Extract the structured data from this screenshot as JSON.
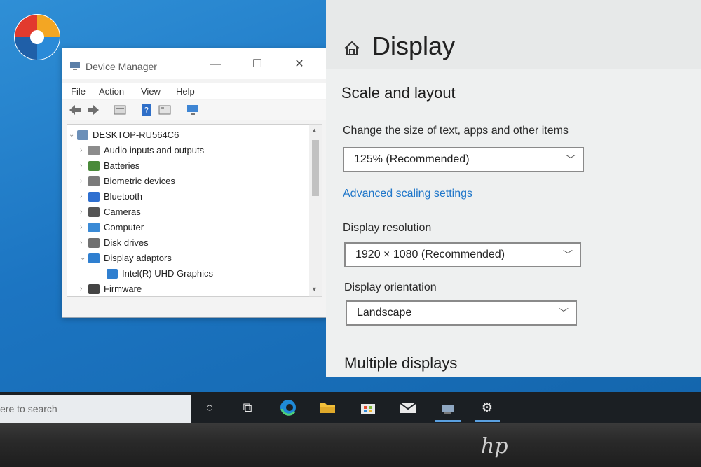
{
  "device_manager": {
    "title": "Device Manager",
    "menu": [
      "File",
      "Action",
      "View",
      "Help"
    ],
    "tree": [
      {
        "label": "DESKTOP-RU564C6",
        "level": 0,
        "expander": "⌄",
        "icon": "computer-root-icon",
        "color": "#6b8fb8"
      },
      {
        "label": "Audio inputs and outputs",
        "level": 1,
        "expander": "›",
        "icon": "speaker-icon",
        "color": "#8c8c8c"
      },
      {
        "label": "Batteries",
        "level": 1,
        "expander": "›",
        "icon": "battery-icon",
        "color": "#4a8a3a"
      },
      {
        "label": "Biometric devices",
        "level": 1,
        "expander": "›",
        "icon": "fingerprint-icon",
        "color": "#7b7b7b"
      },
      {
        "label": "Bluetooth",
        "level": 1,
        "expander": "›",
        "icon": "bluetooth-icon",
        "color": "#2e6fd0"
      },
      {
        "label": "Cameras",
        "level": 1,
        "expander": "›",
        "icon": "camera-icon",
        "color": "#555555"
      },
      {
        "label": "Computer",
        "level": 1,
        "expander": "›",
        "icon": "monitor-icon",
        "color": "#3a8ad6"
      },
      {
        "label": "Disk drives",
        "level": 1,
        "expander": "›",
        "icon": "disk-icon",
        "color": "#707070"
      },
      {
        "label": "Display adaptors",
        "level": 1,
        "expander": "⌄",
        "icon": "display-adapter-icon",
        "color": "#2f7fd0"
      },
      {
        "label": "Intel(R) UHD Graphics",
        "level": 2,
        "expander": "",
        "icon": "display-adapter-icon",
        "color": "#2f7fd0"
      },
      {
        "label": "Firmware",
        "level": 1,
        "expander": "›",
        "icon": "firmware-icon",
        "color": "#444444"
      }
    ]
  },
  "settings": {
    "page_title": "Display",
    "section_scale": "Scale and layout",
    "scale_label": "Change the size of text, apps and other items",
    "scale_value": "125% (Recommended)",
    "advanced_link": "Advanced scaling settings",
    "resolution_label": "Display resolution",
    "resolution_value": "1920 × 1080 (Recommended)",
    "orientation_label": "Display orientation",
    "orientation_value": "Landscape",
    "section_multiple": "Multiple displays"
  },
  "taskbar": {
    "search_placeholder": "ere to search",
    "icons": [
      "cortana-icon",
      "task-view-icon",
      "edge-icon",
      "file-explorer-icon",
      "store-icon",
      "mail-icon",
      "device-manager-icon",
      "settings-gear-icon"
    ]
  },
  "bezel": {
    "brand": "hp"
  },
  "colors": {
    "accent": "#1f76c9",
    "desktop": "#1c75c2",
    "taskbar": "#1b1f23"
  }
}
